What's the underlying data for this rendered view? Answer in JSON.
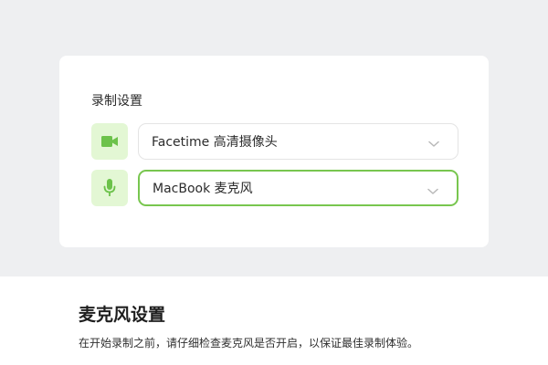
{
  "settings": {
    "section_title": "录制设置",
    "camera": {
      "icon": "video-camera-icon",
      "selected": "Facetime 高清摄像头",
      "focused": false
    },
    "microphone": {
      "icon": "microphone-icon",
      "selected": "MacBook 麦克风",
      "focused": true
    }
  },
  "footer": {
    "title": "麦克风设置",
    "description": "在开始录制之前，请仔细检查麦克风是否开启，以保证最佳录制体验。"
  },
  "colors": {
    "background": "#eeeff1",
    "card": "#ffffff",
    "accent_green": "#6cc24a",
    "icon_tile_bg": "#e3f7d4",
    "focus_border": "#78c64f",
    "idle_border": "#e4e4e4",
    "text": "#2b2b2b"
  }
}
